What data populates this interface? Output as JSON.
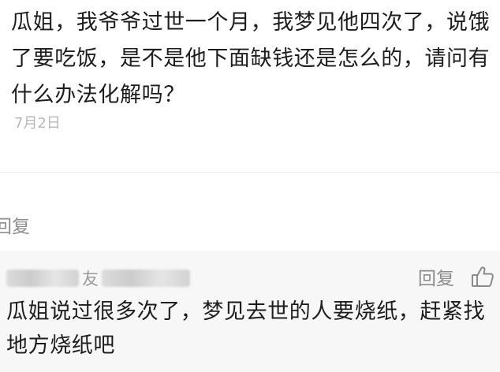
{
  "question": {
    "text": "瓜姐，我爷爷过世一个月，我梦见他四次了，说饿了要吃饭，是不是他下面缺钱还是怎么的，请问有什么办法化解吗？",
    "date": "7月2日"
  },
  "reply_link": "回复",
  "comment": {
    "author_visible_fragment": "友",
    "reply_label": "回复",
    "like_icon": "thumbs-up-icon",
    "text": "瓜姐说过很多次了，梦见去世的人要烧纸，赶紧找地方烧纸吧"
  }
}
